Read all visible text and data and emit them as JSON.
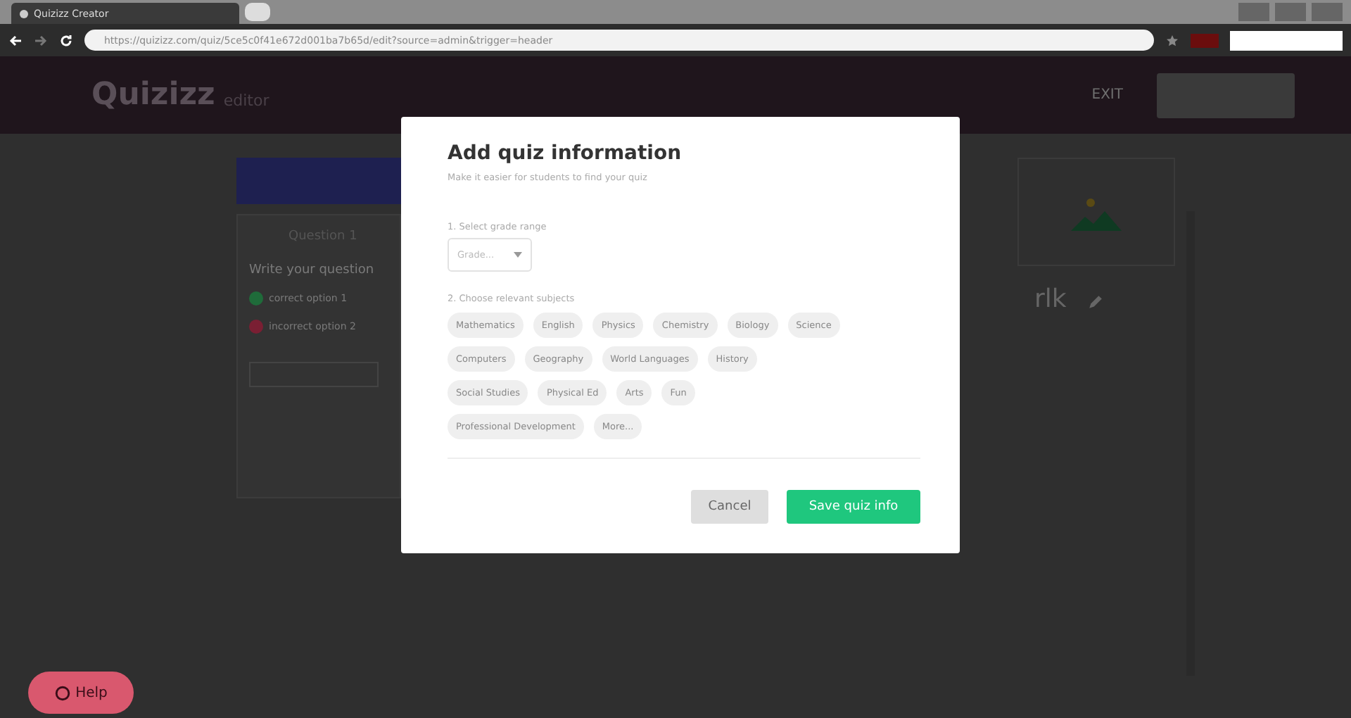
{
  "browser": {
    "tab_title": "Quizizz Creator",
    "url": "https://quizizz.com/quiz/5ce5c0f41e672d001ba7b65d/edit?source=admin&trigger=header"
  },
  "header": {
    "logo": "Quizizz",
    "logo_suffix": "editor",
    "exit": "EXIT"
  },
  "editor": {
    "question_label": "Question 1",
    "prompt": "Write your question",
    "options": [
      {
        "label": "correct option 1",
        "color": "#1f6b3a"
      },
      {
        "label": "incorrect option 2",
        "color": "#7a1f33"
      }
    ]
  },
  "quiz_panel": {
    "title_fragment": "rlk"
  },
  "dialog": {
    "title": "Add quiz information",
    "subtitle": "Make it easier for students to find your quiz",
    "grade_label": "1. Select grade range",
    "grade_placeholder": "Grade...",
    "subjects_label": "2. Choose relevant subjects",
    "subjects": [
      [
        "Mathematics",
        "English",
        "Physics",
        "Chemistry",
        "Biology",
        "Science"
      ],
      [
        "Computers",
        "Geography",
        "World Languages",
        "History"
      ],
      [
        "Social Studies",
        "Physical Ed",
        "Arts",
        "Fun"
      ],
      [
        "Professional Development",
        "More..."
      ]
    ],
    "cancel": "Cancel",
    "save": "Save quiz info"
  },
  "help": "Help"
}
